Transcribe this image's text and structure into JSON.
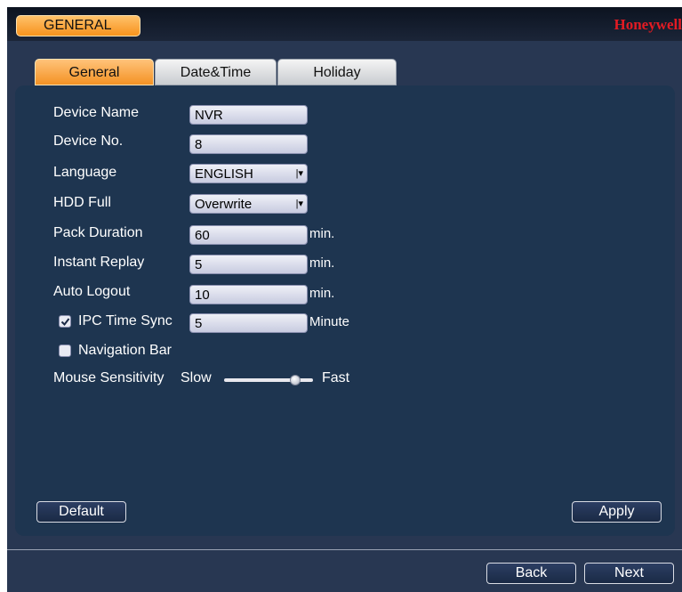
{
  "window": {
    "title": "GENERAL",
    "brand": "Honeywell"
  },
  "tabs": [
    {
      "label": "General",
      "active": true
    },
    {
      "label": "Date&Time",
      "active": false
    },
    {
      "label": "Holiday",
      "active": false
    }
  ],
  "form": {
    "device_name": {
      "label": "Device Name",
      "value": "NVR"
    },
    "device_no": {
      "label": "Device No.",
      "value": "8"
    },
    "language": {
      "label": "Language",
      "value": "ENGLISH"
    },
    "hdd_full": {
      "label": "HDD Full",
      "value": "Overwrite"
    },
    "pack_duration": {
      "label": "Pack Duration",
      "value": "60",
      "unit": "min."
    },
    "instant_replay": {
      "label": "Instant Replay",
      "value": "5",
      "unit": "min."
    },
    "auto_logout": {
      "label": "Auto Logout",
      "value": "10",
      "unit": "min."
    },
    "ipc_time_sync": {
      "label": "IPC Time Sync",
      "checked": true,
      "value": "5",
      "unit": "Minute"
    },
    "navigation_bar": {
      "label": "Navigation Bar",
      "checked": false
    },
    "mouse_sensitivity": {
      "label": "Mouse Sensitivity",
      "min_label": "Slow",
      "max_label": "Fast",
      "level": 0.8
    }
  },
  "buttons": {
    "default": "Default",
    "apply": "Apply",
    "back": "Back",
    "next": "Next"
  },
  "colors": {
    "accent": "#f7931d",
    "brand": "#e21b23",
    "panel": "#1e3550",
    "background": "#283752"
  }
}
